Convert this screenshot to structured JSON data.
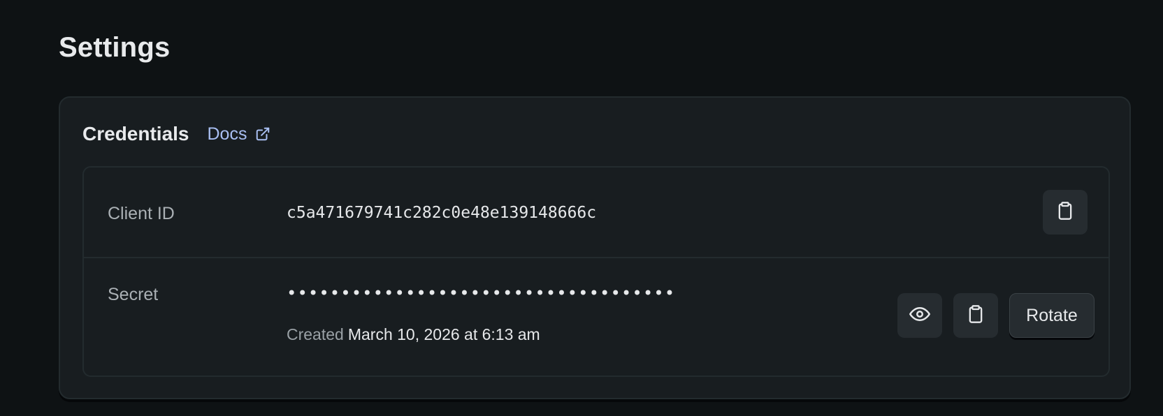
{
  "page": {
    "title": "Settings"
  },
  "credentials": {
    "title": "Credentials",
    "docs_label": "Docs",
    "client_id": {
      "label": "Client ID",
      "value": "c5a471679741c282c0e48e139148666c"
    },
    "secret": {
      "label": "Secret",
      "masked_value": "••••••••••••••••••••••••••••••••••••",
      "created_prefix": "Created",
      "created_date": "March 10, 2026 at 6:13 am",
      "rotate_label": "Rotate"
    }
  },
  "icons": {
    "docs": "external-link-icon",
    "copy": "clipboard-icon",
    "reveal": "eye-icon"
  },
  "colors": {
    "background": "#0e1214",
    "card": "#181d20",
    "border": "#232b2e",
    "link": "#a9bff2",
    "button": "#262c30"
  }
}
